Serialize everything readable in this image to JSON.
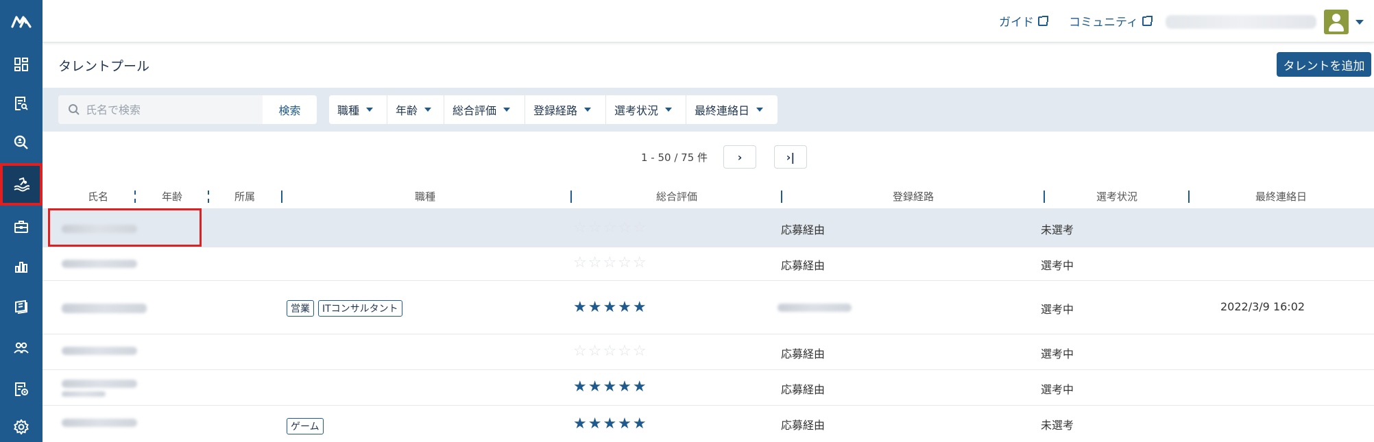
{
  "header": {
    "guide_label": "ガイド",
    "community_label": "コミュニティ"
  },
  "page": {
    "title": "タレントプール",
    "add_button": "タレントを追加"
  },
  "search": {
    "placeholder": "氏名で検索",
    "button": "検索"
  },
  "filters": [
    "職種",
    "年齢",
    "総合評価",
    "登録経路",
    "選考状況",
    "最終連絡日"
  ],
  "pagination": {
    "count_text": "1 - 50 / 75 件",
    "next": "›",
    "last": "›|"
  },
  "columns": [
    "氏名",
    "年齢",
    "所属",
    "職種",
    "総合評価",
    "登録経路",
    "選考状況",
    "最終連絡日"
  ],
  "rows": [
    {
      "tags": [],
      "rating": 0,
      "route": "応募経由",
      "status": "未選考",
      "last_contact": ""
    },
    {
      "tags": [],
      "rating": 0,
      "route": "応募経由",
      "status": "選考中",
      "last_contact": ""
    },
    {
      "tags": [
        "営業",
        "ITコンサルタント"
      ],
      "rating": 5,
      "route": "",
      "status": "選考中",
      "last_contact": "2022/3/9 16:02"
    },
    {
      "tags": [],
      "rating": 0,
      "route": "応募経由",
      "status": "選考中",
      "last_contact": ""
    },
    {
      "tags": [],
      "rating": 5,
      "route": "応募経由",
      "status": "選考中",
      "last_contact": ""
    },
    {
      "tags": [
        "ゲーム"
      ],
      "rating": 5,
      "route": "応募経由",
      "status": "未選考",
      "last_contact": ""
    }
  ],
  "sidebar": {
    "logo": "M",
    "items": [
      "dashboard-icon",
      "job-icon",
      "search-person-icon",
      "talent-pool-icon",
      "briefcase-icon",
      "analytics-icon",
      "book-icon",
      "users-icon",
      "form-settings-icon",
      "gear-icon"
    ]
  },
  "colors": {
    "brand": "#1f5a8e",
    "highlight": "#e02020"
  }
}
